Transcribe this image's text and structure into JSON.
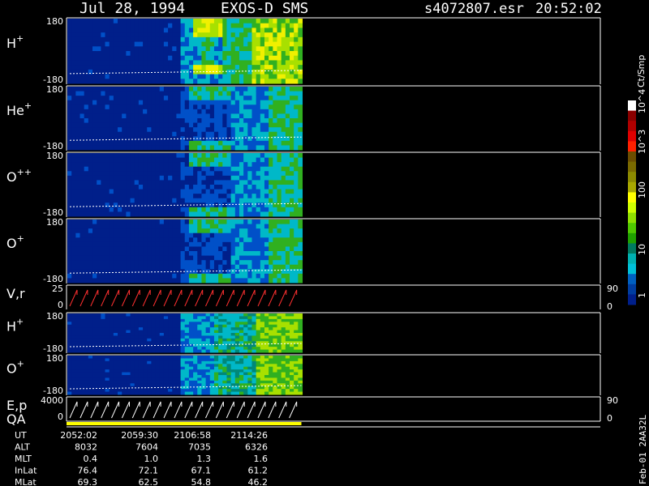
{
  "header": {
    "date": "Jul 28, 1994",
    "instrument": "EXOS-D SMS",
    "file": "s4072807.esr",
    "time": "20:52:02"
  },
  "colorbar": {
    "unit": "Ct/Smp",
    "tick_labels": [
      "10^4",
      "10^3",
      "100",
      "10",
      "1"
    ],
    "colors": [
      "#ffffff",
      "#8b0000",
      "#b00000",
      "#e00000",
      "#ff2000",
      "#6b4d00",
      "#7a6a00",
      "#8c8a00",
      "#a8a800",
      "#ffff00",
      "#cfff00",
      "#8fe000",
      "#50c800",
      "#20a000",
      "#007a60",
      "#00b0b0",
      "#00c0d8",
      "#0060c0",
      "#003da0",
      "#001f8a"
    ]
  },
  "ephemeris": {
    "labels": [
      "UT",
      "ALT",
      "MLT",
      "InLat",
      "MLat"
    ],
    "columns": [
      {
        "UT": "2052:02",
        "ALT": "8032",
        "MLT": "0.4",
        "InLat": "76.4",
        "MLat": "69.3"
      },
      {
        "UT": "2059:30",
        "ALT": "7604",
        "MLT": "1.0",
        "InLat": "72.1",
        "MLat": "62.5"
      },
      {
        "UT": "2106:58",
        "ALT": "7035",
        "MLT": "1.3",
        "InLat": "67.1",
        "MLat": "54.8"
      },
      {
        "UT": "2114:26",
        "ALT": "6326",
        "MLT": "1.6",
        "InLat": "61.2",
        "MLat": "46.2"
      }
    ]
  },
  "footer_right": "Feb-01 2AA32L",
  "chart_data": {
    "type": "heatmap",
    "title": "Jul 28, 1994   EXOS-D SMS",
    "data_extent_fraction": 0.44,
    "panels": [
      {
        "name": "H+",
        "label": "H",
        "sup": "+",
        "y_top": "180",
        "y_bottom": "-180",
        "kind": "spectrogram",
        "ion": "Hp"
      },
      {
        "name": "He+",
        "label": "He",
        "sup": "+",
        "y_top": "180",
        "y_bottom": "-180",
        "kind": "spectrogram",
        "ion": "Hep"
      },
      {
        "name": "O++",
        "label": "O",
        "sup": "++",
        "y_top": "180",
        "y_bottom": "-180",
        "kind": "spectrogram",
        "ion": "Opp"
      },
      {
        "name": "O+",
        "label": "O",
        "sup": "+",
        "y_top": "180",
        "y_bottom": "-180",
        "kind": "spectrogram",
        "ion": "Op"
      },
      {
        "name": "V,r",
        "label": "V,r",
        "sup": "",
        "y_top": "25",
        "y_bottom": "0",
        "right_top": "90",
        "right_bottom": "0",
        "kind": "lines",
        "line_color": "#ff3030"
      },
      {
        "name": "H+ (2)",
        "label": "H",
        "sup": "+",
        "y_top": "180",
        "y_bottom": "-180",
        "kind": "spectrogram",
        "ion": "Hp2"
      },
      {
        "name": "O+ (2)",
        "label": "O",
        "sup": "+",
        "y_top": "180",
        "y_bottom": "-180",
        "kind": "spectrogram",
        "ion": "Op2"
      },
      {
        "name": "E,p",
        "label": "E,p",
        "sup": "",
        "y_top": "4000",
        "y_bottom": "0",
        "right_top": "90",
        "right_bottom": "0",
        "kind": "lines",
        "line_color": "#ffffff"
      },
      {
        "name": "QA",
        "label": "QA",
        "sup": "",
        "kind": "qa"
      }
    ]
  }
}
